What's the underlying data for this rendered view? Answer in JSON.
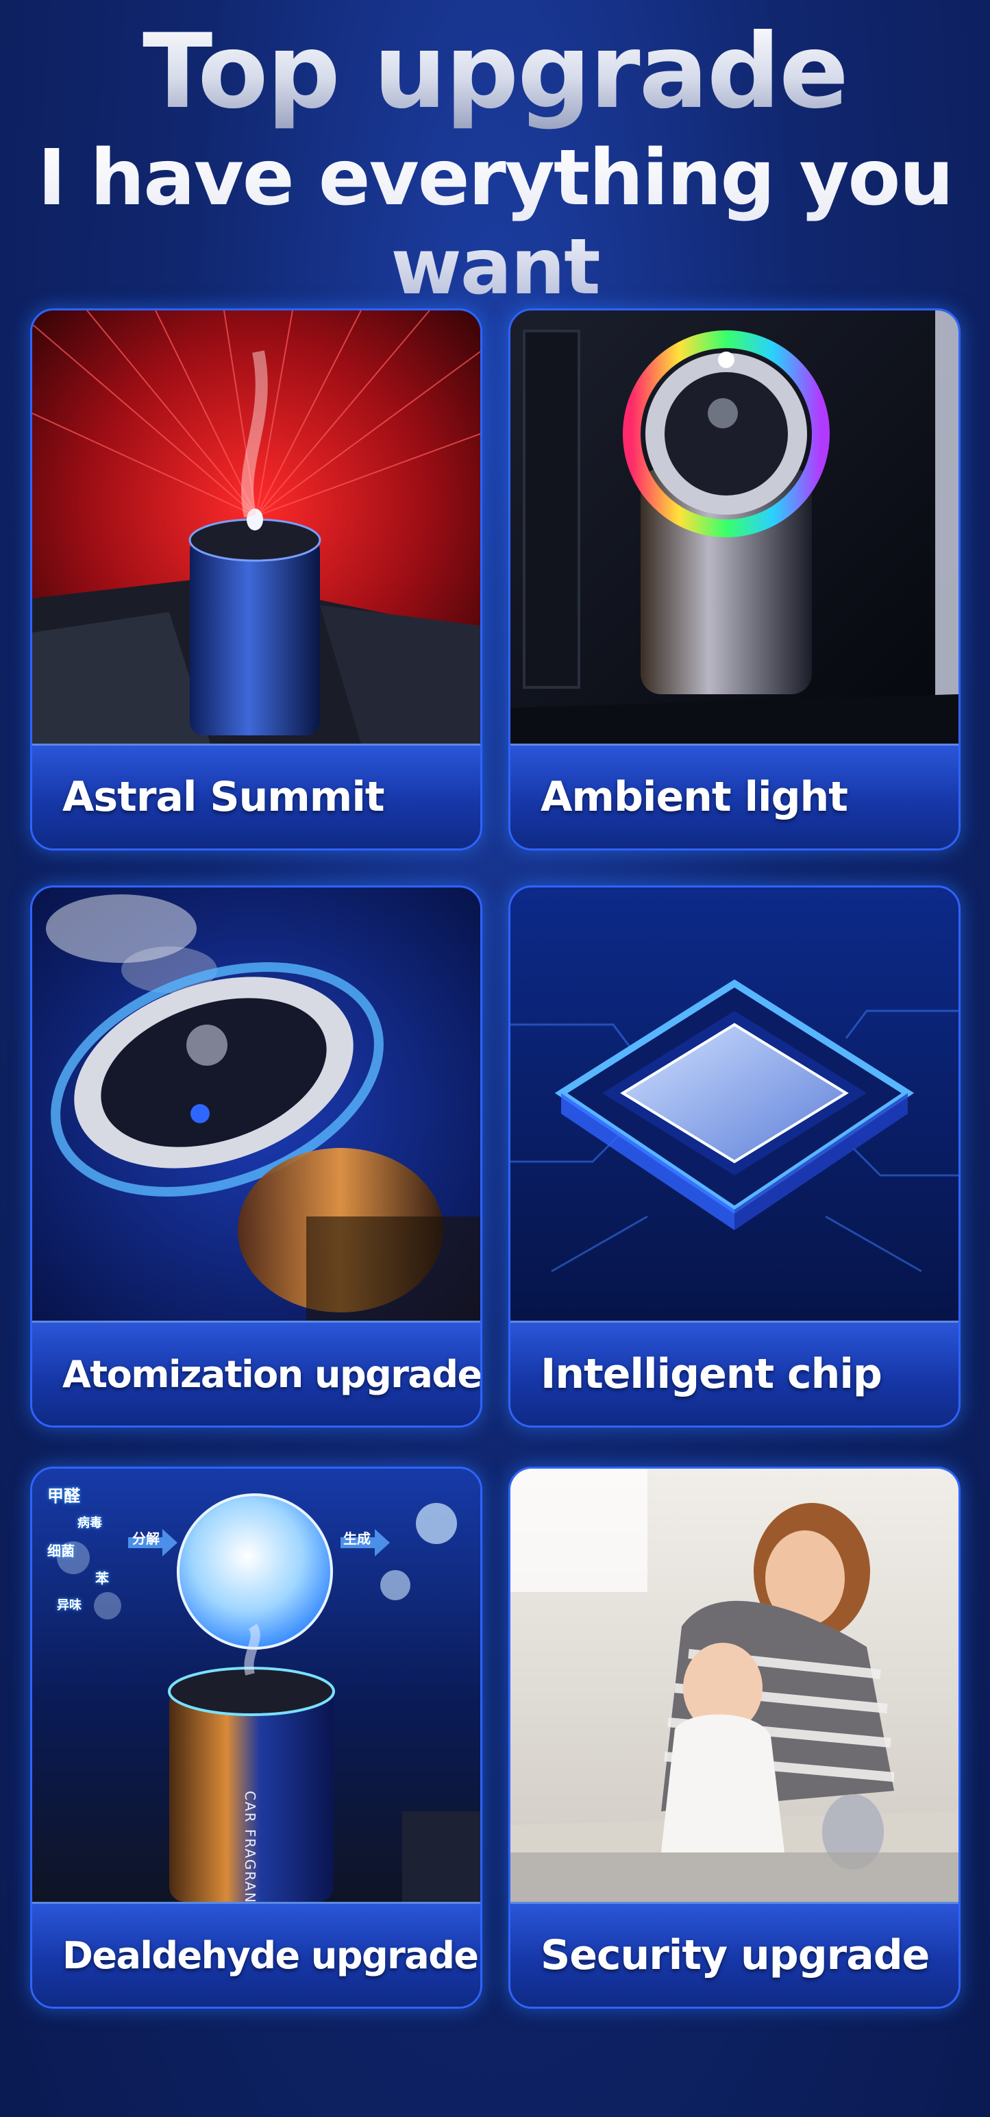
{
  "header": {
    "title": "Top upgrade",
    "subtitle": "I have everything you want"
  },
  "features": [
    {
      "label": "Astral Summit"
    },
    {
      "label": "Ambient light"
    },
    {
      "label": "Atomization upgrade"
    },
    {
      "label": "Intelligent chip"
    },
    {
      "label": "Dealdehyde upgrade"
    },
    {
      "label": "Security upgrade"
    }
  ],
  "product": {
    "brand_text": "CAR FRAGRANCE"
  },
  "diagram": {
    "left_labels": [
      "甲醛",
      "病毒",
      "细菌",
      "苯",
      "异味"
    ],
    "arrow_1": "分解",
    "arrow_2": "生成"
  },
  "colors": {
    "accent": "#2f63ff",
    "label_bar": "#1637a8",
    "background": "#10266e"
  }
}
